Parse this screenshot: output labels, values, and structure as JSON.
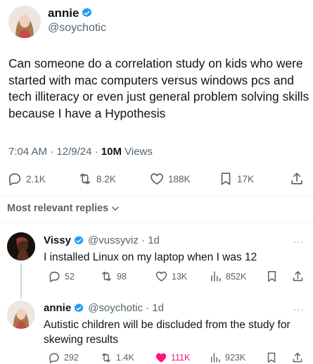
{
  "tweet": {
    "name": "annie",
    "handle": "@soychotic",
    "text": "Can someone do a correlation study on kids who were started with mac computers versus windows pcs and tech illiteracy or even just general problem solving skills because I have a Hypothesis",
    "time": "7:04 AM",
    "date": "12/9/24",
    "views_count": "10M",
    "views_label": "Views",
    "actions": {
      "replies": "2.1K",
      "retweets": "8.2K",
      "likes": "188K",
      "bookmarks": "17K"
    }
  },
  "replies_sort_label": "Most relevant replies",
  "replies": [
    {
      "name": "Vissy",
      "handle": "@vussyviz",
      "time": "1d",
      "text": "I installed Linux on my laptop when I was 12",
      "actions": {
        "replies": "52",
        "retweets": "98",
        "likes": "13K",
        "views": "852K"
      }
    },
    {
      "name": "annie",
      "handle": "@soychotic",
      "time": "1d",
      "text": "Autistic children will be discluded from the study for skewing results",
      "actions": {
        "replies": "292",
        "retweets": "1.4K",
        "likes": "111K",
        "views": "923K"
      },
      "liked": true
    }
  ],
  "colors": {
    "verified": "#1d9bf0",
    "secondary_text": "#536471",
    "liked": "#f91880"
  },
  "icons": [
    "verified-icon",
    "reply-icon",
    "retweet-icon",
    "like-icon",
    "bookmark-icon",
    "share-icon",
    "views-icon",
    "chevron-down-icon",
    "more-icon"
  ]
}
